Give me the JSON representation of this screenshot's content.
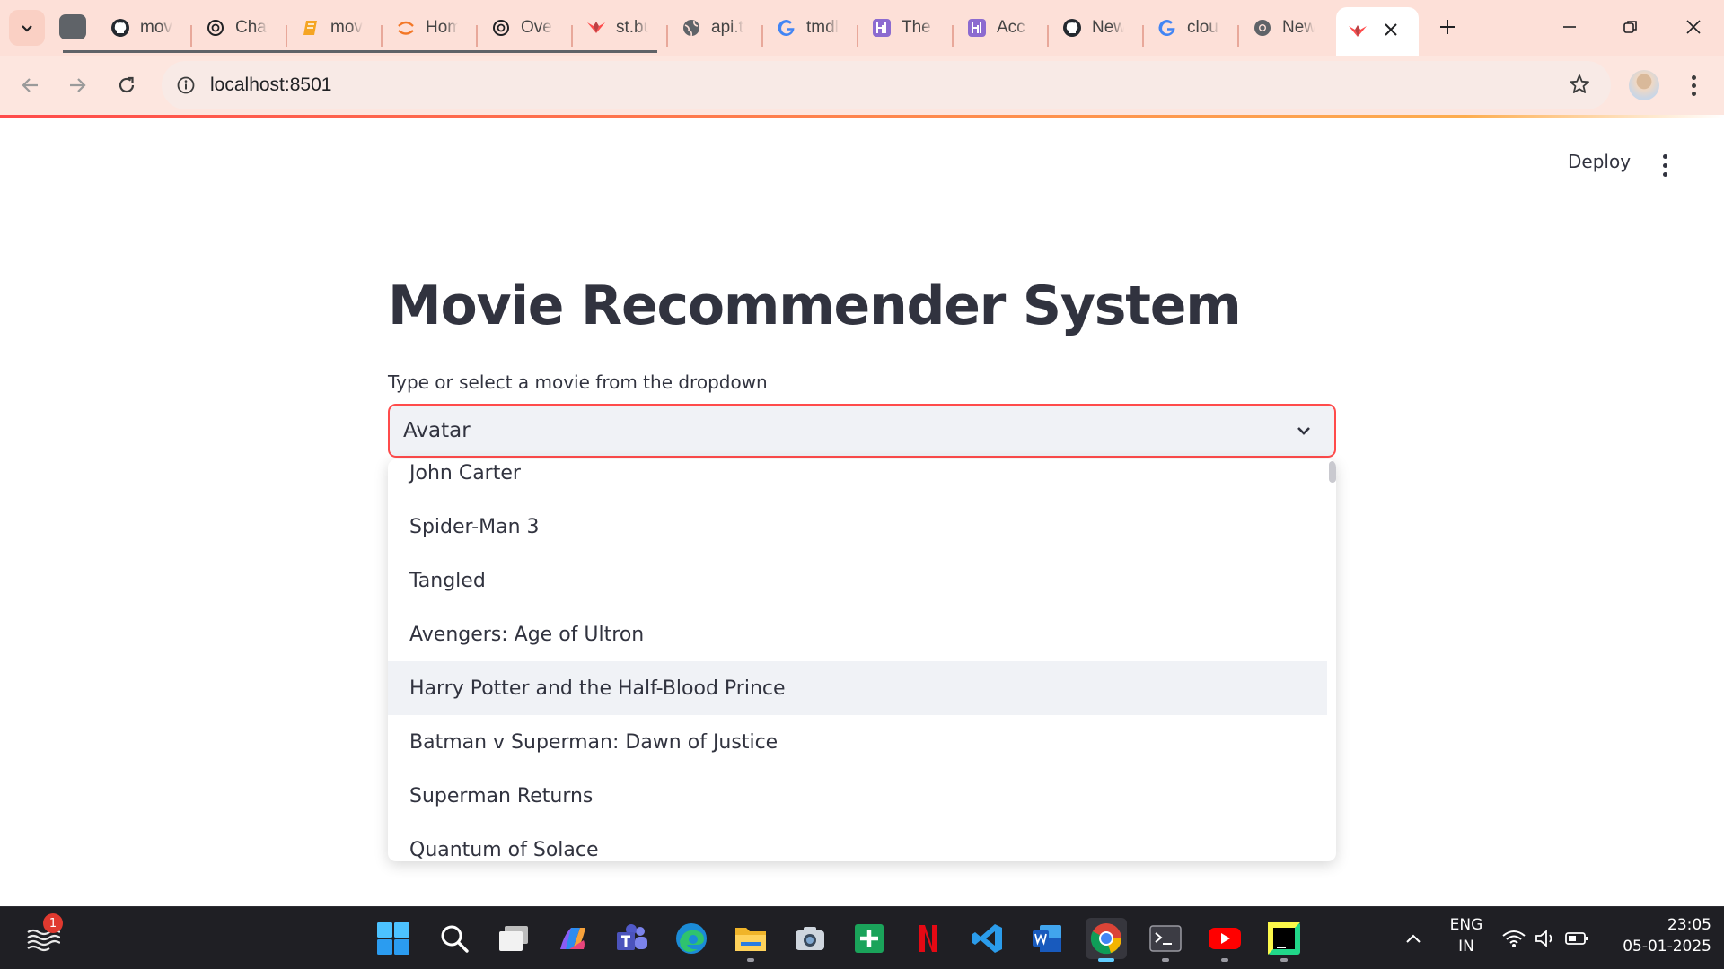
{
  "browser": {
    "tabs": [
      {
        "title": "mov",
        "icon": "github-icon"
      },
      {
        "title": "Chat",
        "icon": "openai-icon"
      },
      {
        "title": "mov",
        "icon": "notebook-icon"
      },
      {
        "title": "Hom",
        "icon": "jupyter-icon"
      },
      {
        "title": "Over",
        "icon": "openai-icon"
      },
      {
        "title": "st.bu",
        "icon": "streamlit-icon"
      },
      {
        "title": "api.t",
        "icon": "globe-icon"
      },
      {
        "title": "tmdl",
        "icon": "google-icon"
      },
      {
        "title": "The",
        "icon": "hackmd-icon"
      },
      {
        "title": "Acc",
        "icon": "hackmd-icon"
      },
      {
        "title": "New",
        "icon": "github-icon"
      },
      {
        "title": "clou",
        "icon": "google-icon"
      },
      {
        "title": "New",
        "icon": "chrome-icon"
      },
      {
        "title": "",
        "icon": "streamlit-icon",
        "active": true
      }
    ],
    "url": "localhost:8501"
  },
  "app": {
    "deploy_label": "Deploy",
    "title": "Movie Recommender System",
    "select_label": "Type or select a movie from the dropdown",
    "selected_value": "Avatar",
    "options": [
      "John Carter",
      "Spider-Man 3",
      "Tangled",
      "Avengers: Age of Ultron",
      "Harry Potter and the Half-Blood Prince",
      "Batman v Superman: Dawn of Justice",
      "Superman Returns",
      "Quantum of Solace"
    ],
    "hovered_option": "Harry Potter and the Half-Blood Prince",
    "accent_color": "#ff4b4b"
  },
  "taskbar": {
    "weather_badge": "1",
    "lang_line1": "ENG",
    "lang_line2": "IN",
    "time": "23:05",
    "date": "05-01-2025"
  }
}
